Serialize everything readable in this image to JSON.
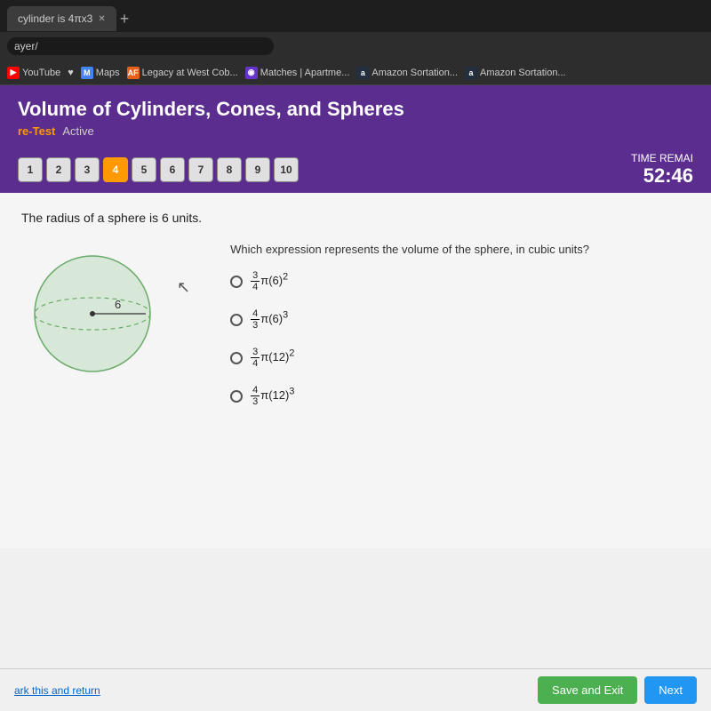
{
  "browser": {
    "tab_title": "cylinder is 4πx3",
    "address": "ayer/",
    "bookmarks": [
      {
        "label": "YouTube",
        "icon": "YT",
        "class": "fav-yt"
      },
      {
        "label": "Maps",
        "icon": "M",
        "class": "fav-maps"
      },
      {
        "label": "Legacy at West Cob...",
        "icon": "AF",
        "class": "fav-af"
      },
      {
        "label": "Matches | Apartme...",
        "icon": "◉",
        "class": "fav-matches"
      },
      {
        "label": "Amazon Sortation...",
        "icon": "a",
        "class": "fav-amazon"
      },
      {
        "label": "Amazon Sortation...",
        "icon": "a",
        "class": "fav-amazon2"
      }
    ]
  },
  "page": {
    "title": "Volume of Cylinders, Cones, and Spheres",
    "pre_test_label": "re-Test",
    "active_label": "Active",
    "question_numbers": [
      "1",
      "2",
      "3",
      "4",
      "5",
      "6",
      "7",
      "8",
      "9",
      "10"
    ],
    "active_question": 4,
    "time_remaining_label": "TIME REMAI",
    "time_value": "52:46",
    "question_statement": "The radius of a sphere is 6 units.",
    "radius_label": "6",
    "answer_prompt": "Which expression represents the volume of the sphere, in cubic units?",
    "choices": [
      {
        "id": "A",
        "html": "(3/4)π(6)²"
      },
      {
        "id": "B",
        "html": "(4/3)π(6)³"
      },
      {
        "id": "C",
        "html": "(3/4)π(12)²"
      },
      {
        "id": "D",
        "html": "(4/3)π(12)³"
      }
    ],
    "mark_return_label": "ark this and return",
    "save_exit_label": "Save and Exit",
    "next_label": "Next"
  }
}
